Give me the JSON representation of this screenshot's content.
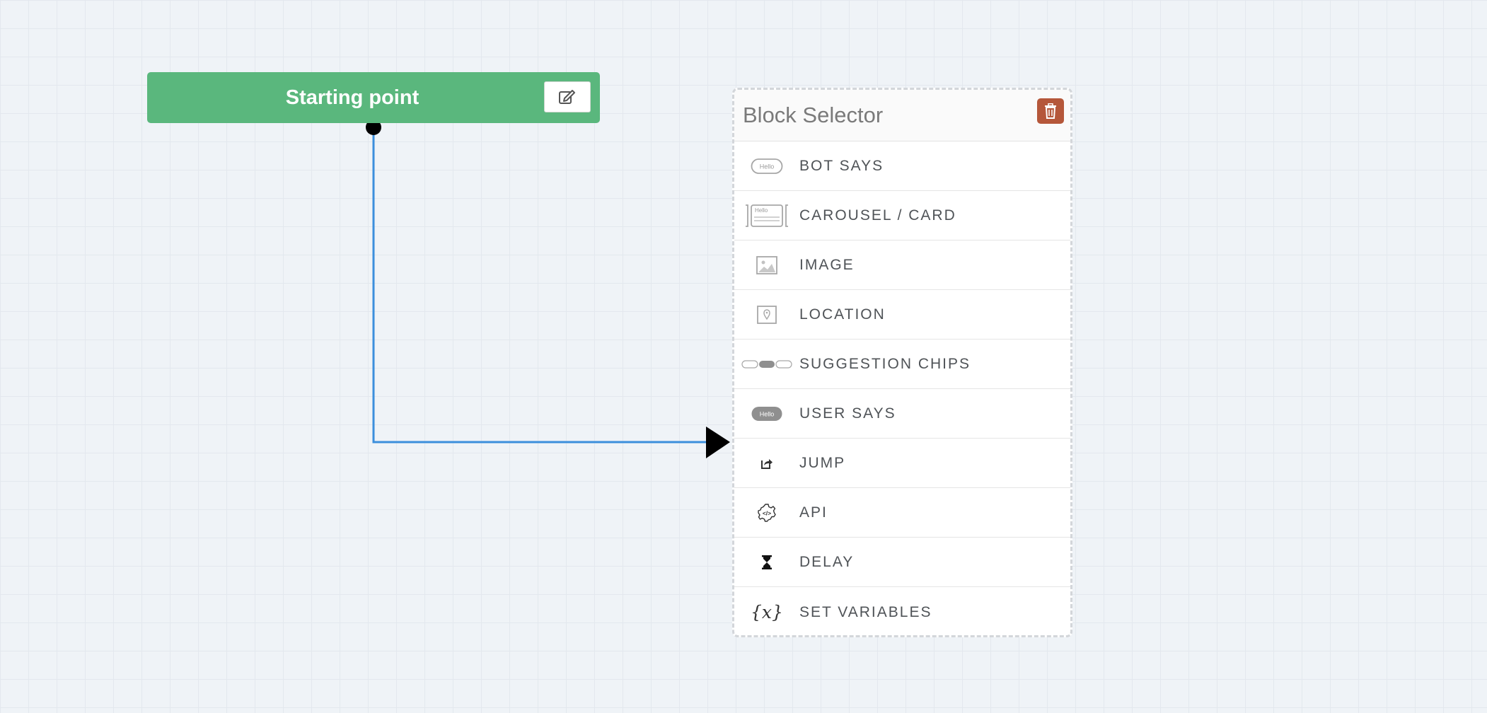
{
  "start_node": {
    "title": "Starting point",
    "edit_icon": "edit-icon"
  },
  "block_selector": {
    "title": "Block Selector",
    "delete_icon": "trash-icon",
    "delete_color": "#b5573a",
    "items": [
      {
        "label": "BOT SAYS",
        "icon": "bot-says-icon",
        "icon_text": "Hello"
      },
      {
        "label": "CAROUSEL / CARD",
        "icon": "carousel-card-icon",
        "icon_text": "Hello"
      },
      {
        "label": "IMAGE",
        "icon": "image-icon"
      },
      {
        "label": "LOCATION",
        "icon": "location-icon"
      },
      {
        "label": "SUGGESTION CHIPS",
        "icon": "suggestion-chips-icon"
      },
      {
        "label": "USER SAYS",
        "icon": "user-says-icon",
        "icon_text": "Hello"
      },
      {
        "label": "JUMP",
        "icon": "jump-icon"
      },
      {
        "label": "API",
        "icon": "api-gear-icon"
      },
      {
        "label": "DELAY",
        "icon": "hourglass-icon"
      },
      {
        "label": "SET VARIABLES",
        "icon": "variable-braces-icon",
        "icon_text": "{x}"
      }
    ]
  },
  "colors": {
    "start_node": "#5ab77d",
    "connector": "#3c8fdc",
    "background": "#eff3f7"
  }
}
